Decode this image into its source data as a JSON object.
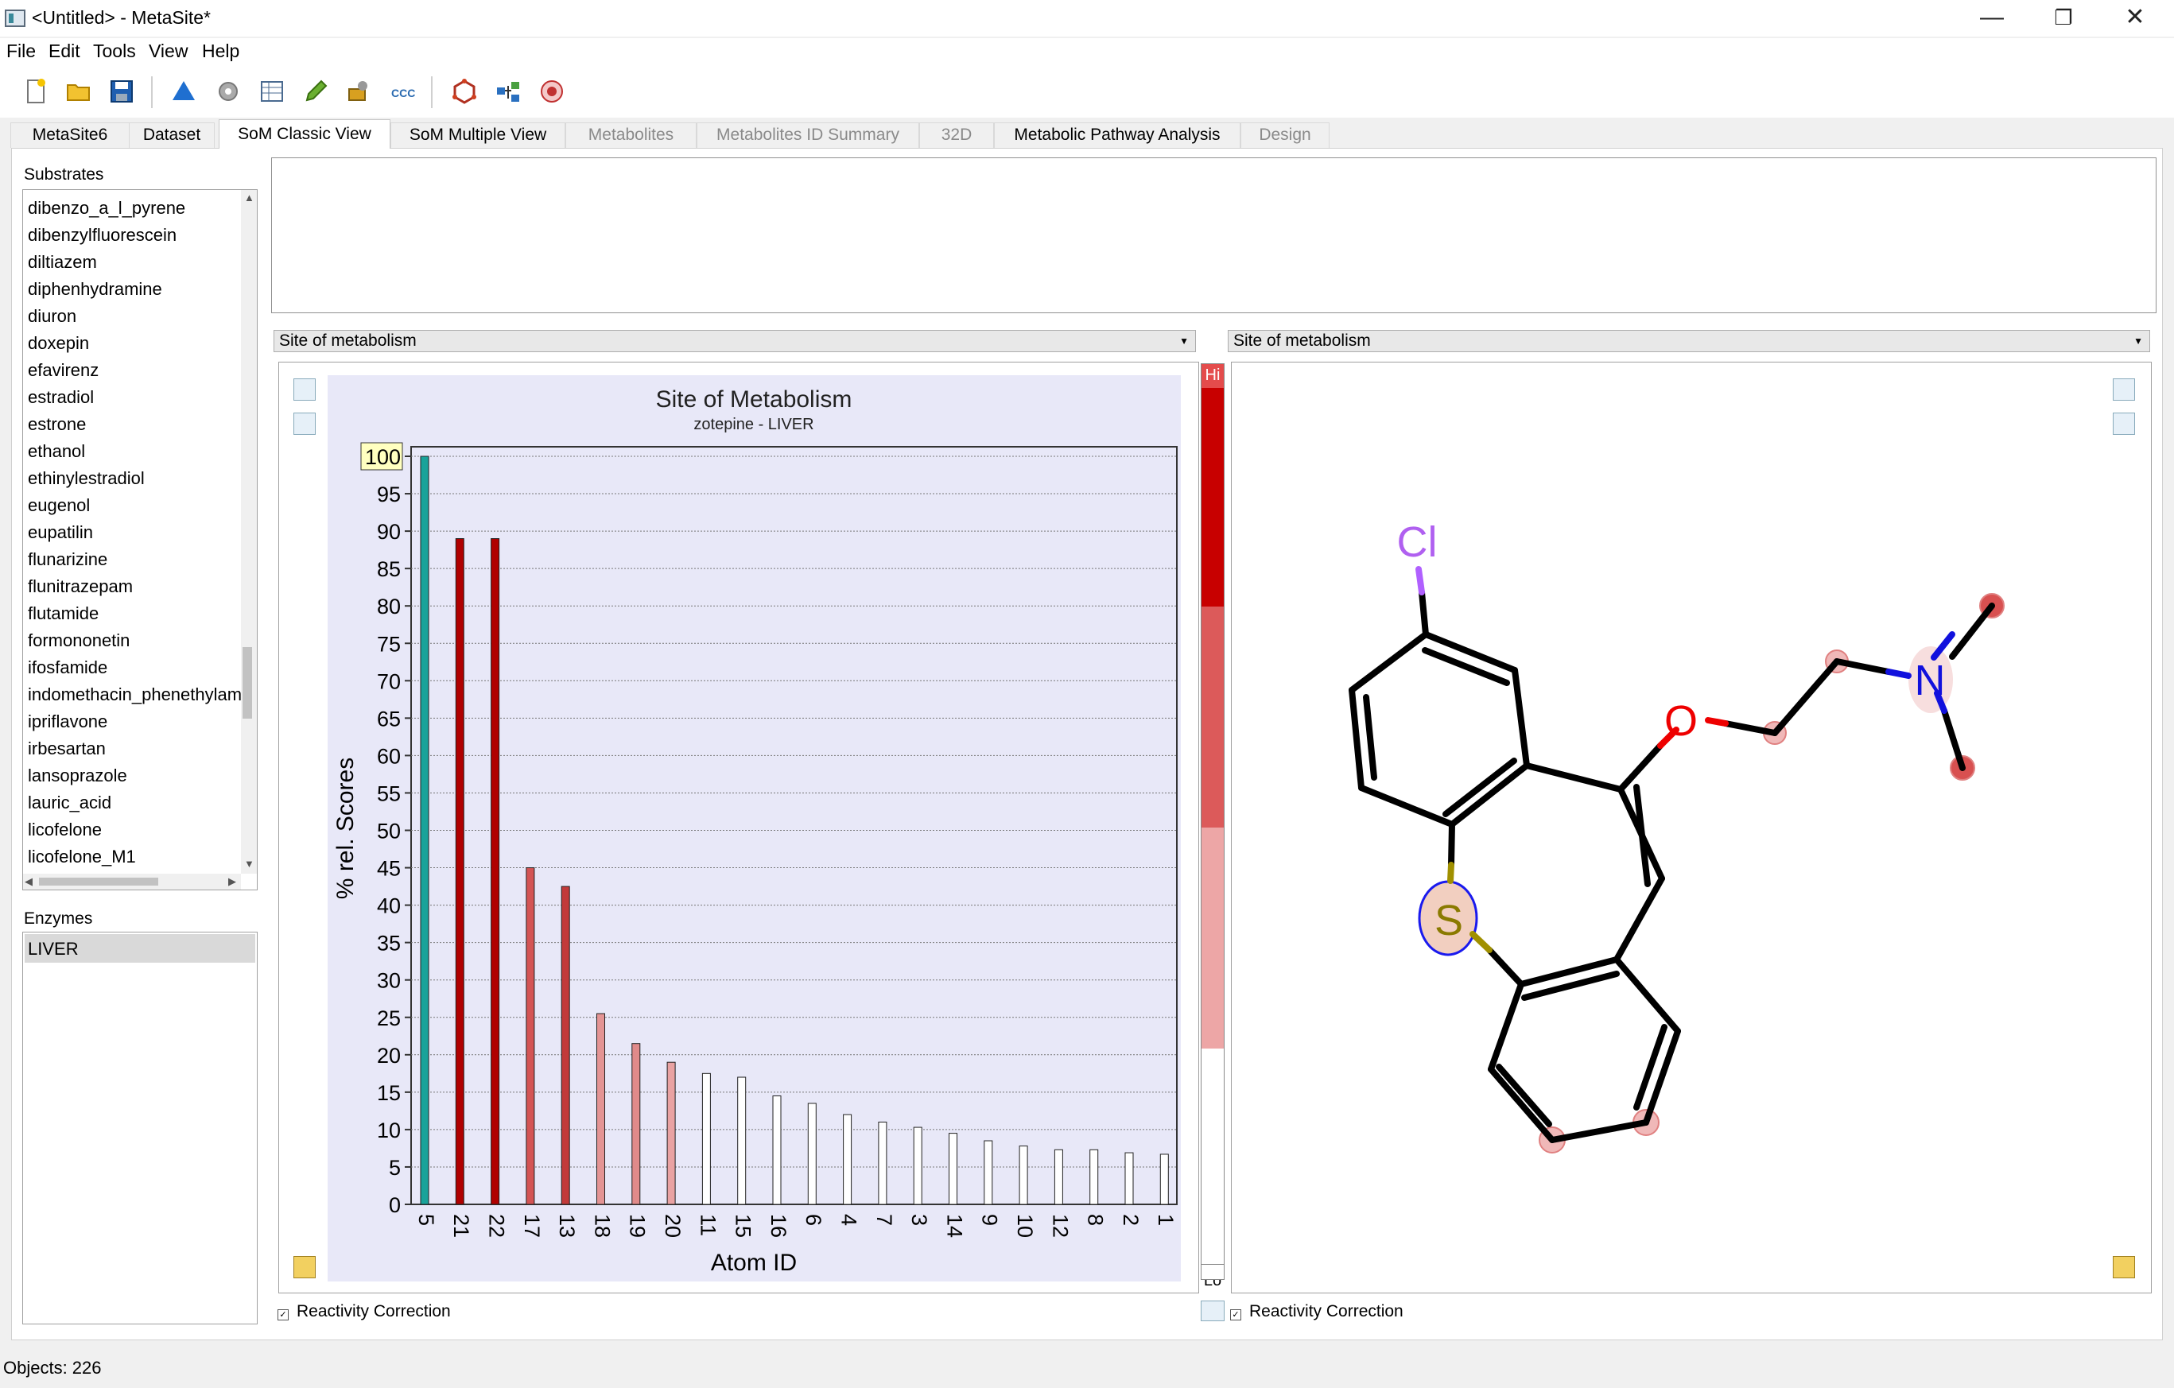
{
  "window": {
    "title": "<Untitled> - MetaSite*"
  },
  "menu": [
    "File",
    "Edit",
    "Tools",
    "View",
    "Help"
  ],
  "toolbar": {
    "icons": [
      "new-file-icon",
      "open-folder-icon",
      "save-icon",
      "triangle-icon",
      "molecule-gear-icon",
      "table-icon",
      "pencil-icon",
      "settings-tools-icon",
      "ccc-icon",
      "hex-molecule-icon",
      "pathway-icon",
      "target-icon"
    ]
  },
  "tabs": [
    {
      "label": "MetaSite6",
      "state": "normal"
    },
    {
      "label": "Dataset",
      "state": "normal"
    },
    {
      "label": "SoM Classic View",
      "state": "active"
    },
    {
      "label": "SoM Multiple View",
      "state": "normal"
    },
    {
      "label": "Metabolites",
      "state": "disabled"
    },
    {
      "label": "Metabolites ID Summary",
      "state": "disabled"
    },
    {
      "label": "32D",
      "state": "disabled"
    },
    {
      "label": "Metabolic Pathway Analysis",
      "state": "normal"
    },
    {
      "label": "Design",
      "state": "disabled"
    }
  ],
  "substrates": {
    "label": "Substrates",
    "items": [
      "dibenzo_a_l_pyrene",
      "dibenzylfluorescein",
      "diltiazem",
      "diphenhydramine",
      "diuron",
      "doxepin",
      "efavirenz",
      "estradiol",
      "estrone",
      "ethanol",
      "ethinylestradiol",
      "eugenol",
      "eupatilin",
      "flunarizine",
      "flunitrazepam",
      "flutamide",
      "formononetin",
      "ifosfamide",
      "indomethacin_phenethylamide",
      "ipriflavone",
      "irbesartan",
      "lansoprazole",
      "lauric_acid",
      "licofelone",
      "licofelone_M1"
    ]
  },
  "enzymes": {
    "label": "Enzymes",
    "items": [
      "LIVER"
    ]
  },
  "left_view": {
    "selector": "Site of metabolism",
    "reactivity_label": "Reactivity Correction"
  },
  "right_view": {
    "selector": "Site of metabolism",
    "reactivity_label": "Reactivity Correction"
  },
  "colorbar": {
    "hi": "Hi",
    "lo": "Lo"
  },
  "chart_data": {
    "type": "bar",
    "title": "Site of Metabolism",
    "subtitle": "zotepine - LIVER",
    "xlabel": "Atom ID",
    "ylabel": "% rel. Scores",
    "ylim": [
      0,
      100
    ],
    "yticks": [
      0,
      5,
      10,
      15,
      20,
      25,
      30,
      35,
      40,
      45,
      50,
      55,
      60,
      65,
      70,
      75,
      80,
      85,
      90,
      95,
      100
    ],
    "highlight_label": "100",
    "categories": [
      "5",
      "21",
      "22",
      "17",
      "13",
      "18",
      "19",
      "20",
      "11",
      "15",
      "16",
      "6",
      "4",
      "7",
      "3",
      "14",
      "9",
      "10",
      "12",
      "8",
      "2",
      "1"
    ],
    "values": [
      100,
      89,
      89,
      45,
      42.5,
      25.5,
      21.5,
      19,
      17.5,
      17,
      14.5,
      13.5,
      12,
      11,
      10.3,
      9.5,
      8.5,
      7.8,
      7.3,
      7.3,
      6.9,
      6.7
    ],
    "colors": [
      "#1aa39a",
      "#b00000",
      "#b00000",
      "#d45454",
      "#c23a3a",
      "#e49494",
      "#e08a8a",
      "#e9a2a2",
      "#ffffff",
      "#ffffff",
      "#ffffff",
      "#ffffff",
      "#ffffff",
      "#ffffff",
      "#ffffff",
      "#ffffff",
      "#ffffff",
      "#ffffff",
      "#ffffff",
      "#ffffff",
      "#ffffff",
      "#ffffff"
    ],
    "grid": true,
    "background": "#e8e8f8"
  },
  "molecule": {
    "name": "zotepine",
    "atom_labels": [
      "Cl",
      "O",
      "N",
      "S"
    ]
  },
  "status": {
    "text": "Objects: 226"
  }
}
